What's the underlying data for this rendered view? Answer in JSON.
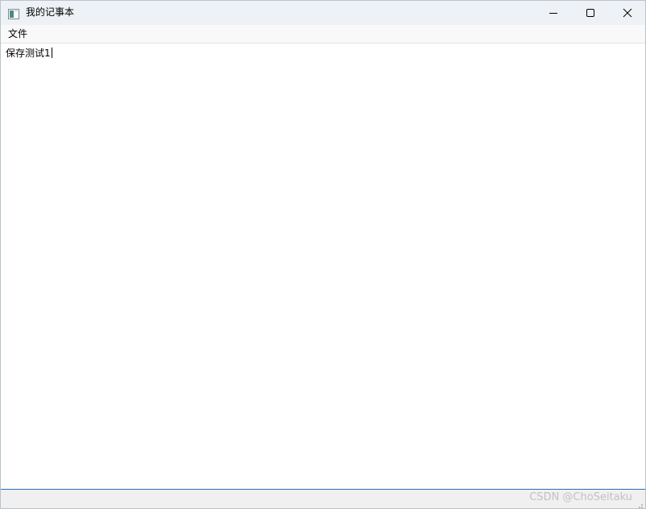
{
  "window": {
    "title": "我的记事本",
    "app_icon": "notepad-app-icon",
    "controls": {
      "minimize_icon": "minimize-icon",
      "maximize_icon": "maximize-icon",
      "close_icon": "close-icon"
    }
  },
  "menubar": {
    "items": [
      {
        "label": "文件"
      }
    ]
  },
  "editor": {
    "content": "保存测试1"
  },
  "statusbar": {
    "watermark": "CSDN @ChoSeitaku"
  },
  "colors": {
    "titlebar_bg": "#eef2f6",
    "status_border": "#2a6ab4",
    "watermark": "#c2c2c2"
  }
}
